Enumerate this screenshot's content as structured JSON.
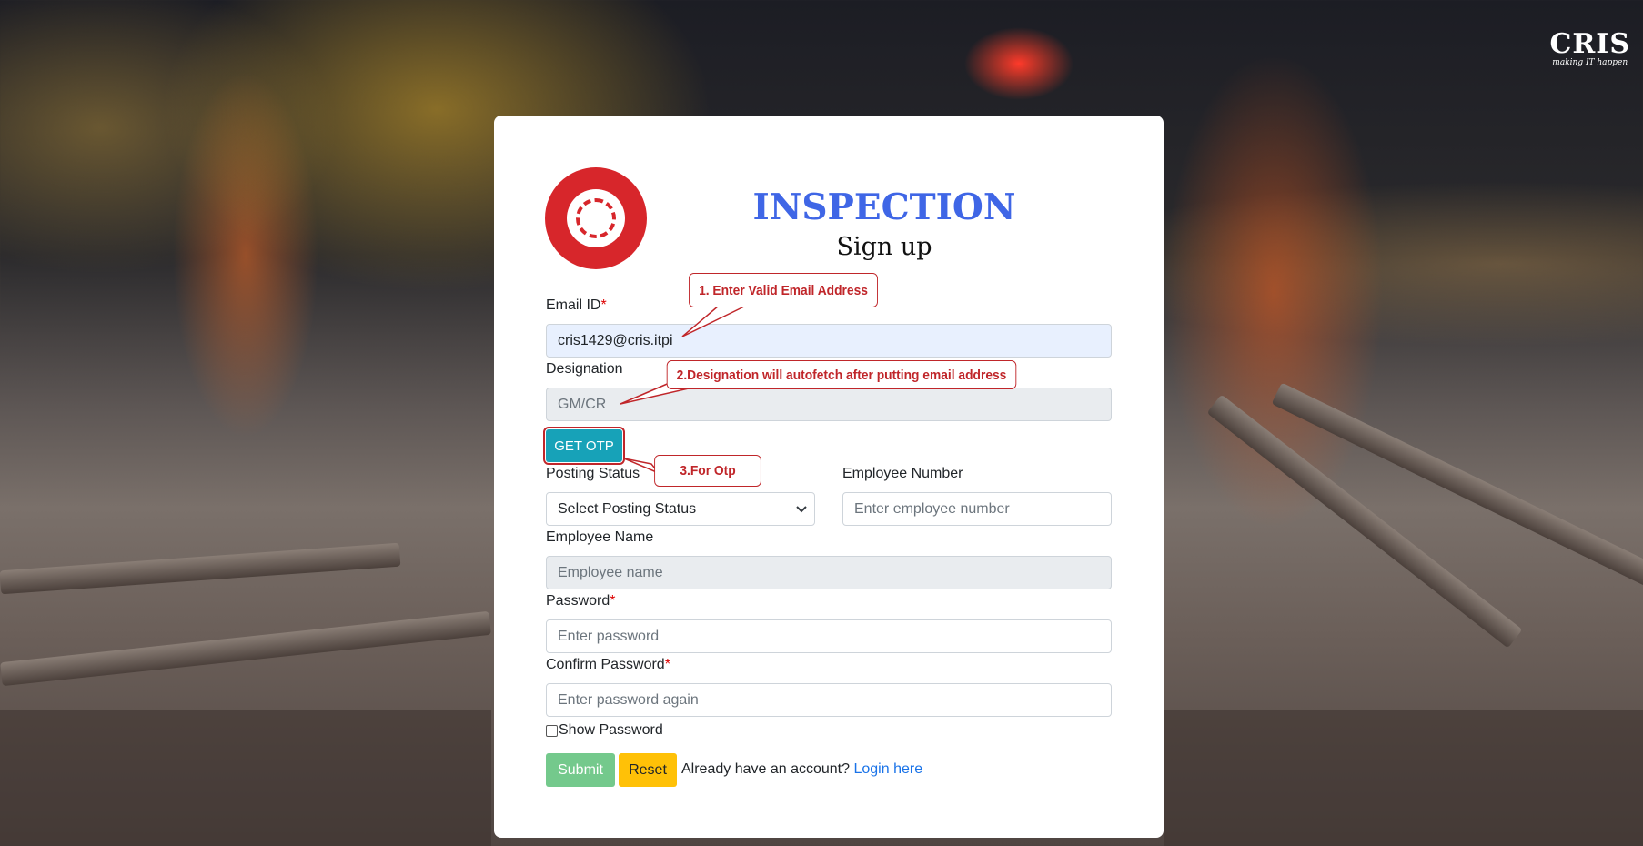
{
  "brand": {
    "name": "CRIS",
    "tagline": "making IT happen"
  },
  "form": {
    "title": "INSPECTION",
    "subtitle": "Sign up",
    "email": {
      "label": "Email ID",
      "required_mark": "*",
      "value": "cris1429@cris.itpi"
    },
    "designation": {
      "label": "Designation",
      "value": "GM/CR"
    },
    "otp_button": "GET OTP",
    "posting_status": {
      "label": "Posting Status",
      "selected": "Select Posting Status"
    },
    "employee_number": {
      "label": "Employee Number",
      "placeholder": "Enter employee number"
    },
    "employee_name": {
      "label": "Employee Name",
      "placeholder": "Employee name"
    },
    "password": {
      "label": "Password",
      "required_mark": "*",
      "placeholder": "Enter password"
    },
    "confirm_password": {
      "label": "Confirm Password",
      "required_mark": "*",
      "placeholder": "Enter password again"
    },
    "show_password": "Show Password",
    "submit": "Submit",
    "reset": "Reset",
    "already_text": "Already have an account?",
    "login_link": "Login here"
  },
  "annotations": {
    "step1": "1. Enter Valid Email Address",
    "step2": "2.Designation will autofetch after putting email address",
    "step3": "3.For Otp"
  },
  "colors": {
    "accent": "#3f66e6",
    "otp": "#17a2b8",
    "submit": "#74c98c",
    "reset": "#ffc107",
    "callout": "#c0262a"
  }
}
